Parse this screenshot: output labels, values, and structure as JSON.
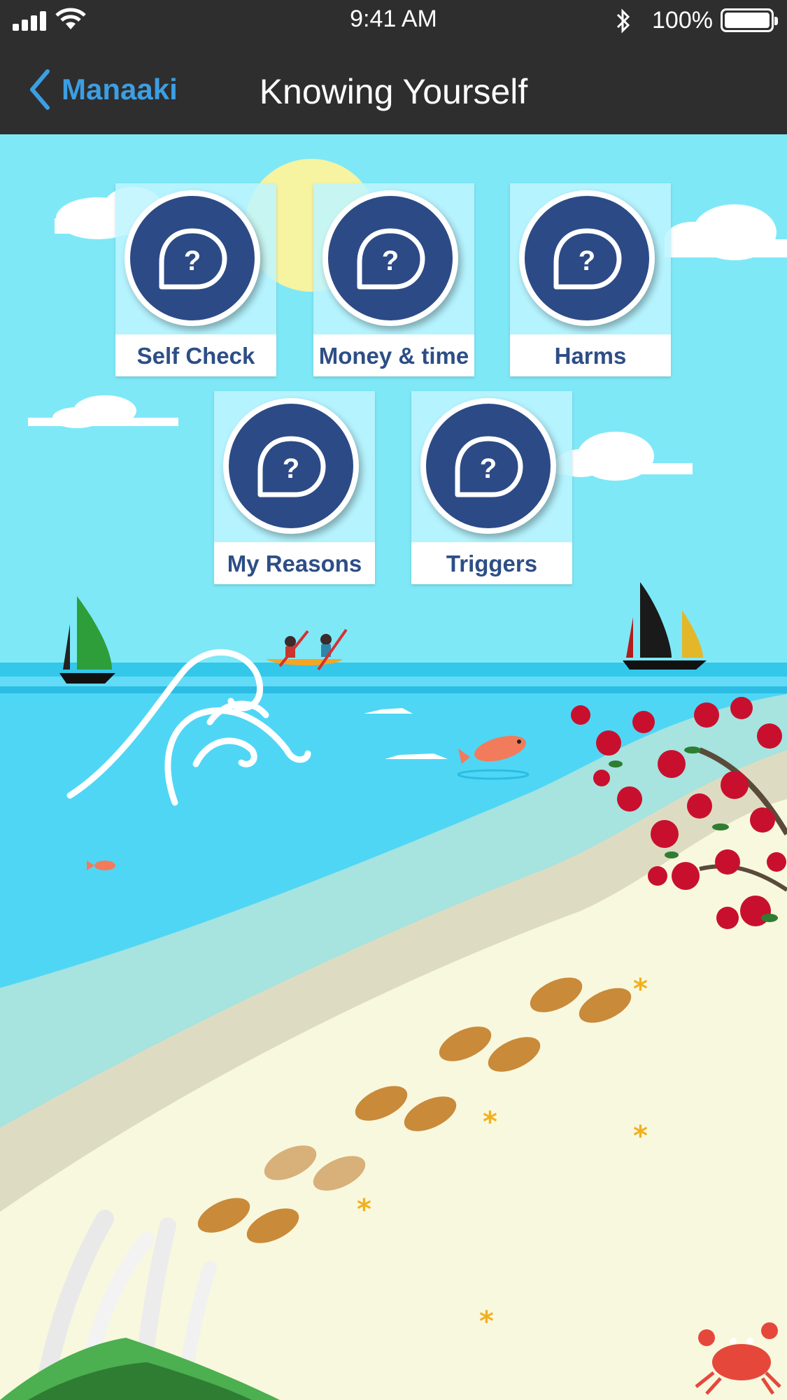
{
  "status_bar": {
    "time": "9:41 AM",
    "battery_percent": "100%",
    "signal_icon": "cellular-signal-icon",
    "wifi_icon": "wifi-icon",
    "bluetooth_icon": "bluetooth-icon",
    "battery_icon": "battery-icon",
    "battery_level": 1.0
  },
  "nav": {
    "back_label": "Manaaki",
    "back_icon": "chevron-left-icon",
    "title": "Knowing Yourself"
  },
  "tiles": [
    {
      "label": "Self Check",
      "icon": "question-bubble-icon"
    },
    {
      "label": "Money & time",
      "icon": "question-bubble-icon"
    },
    {
      "label": "Harms",
      "icon": "question-bubble-icon"
    },
    {
      "label": "My Reasons",
      "icon": "question-bubble-icon"
    },
    {
      "label": "Triggers",
      "icon": "question-bubble-icon"
    }
  ],
  "colors": {
    "nav_background": "#2e2e2e",
    "accent_blue": "#3d9ee2",
    "tile_circle": "#2c4a86",
    "tile_label_text": "#2d4e86",
    "sky": "#7ee8f7",
    "sea": "#4fd6f5",
    "sand": "#f8f8de"
  }
}
